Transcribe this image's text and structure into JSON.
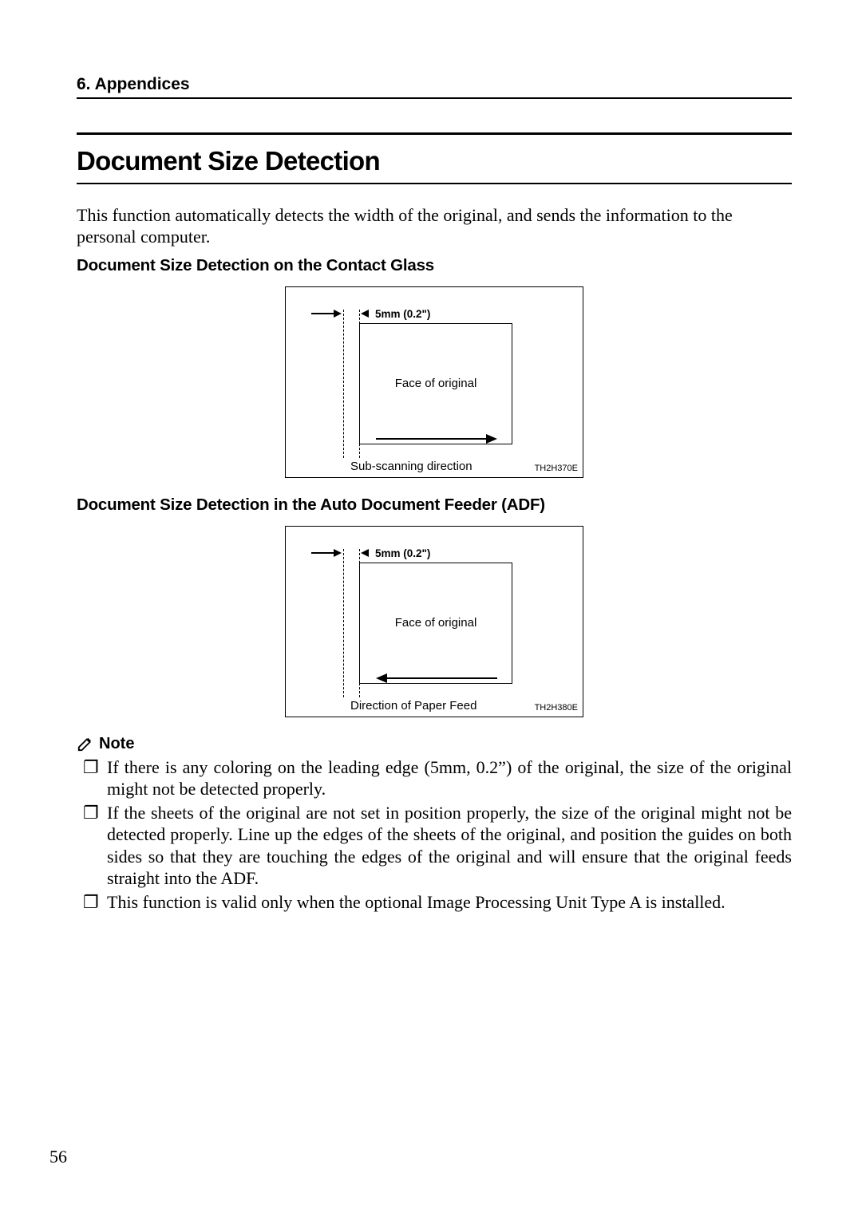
{
  "header": {
    "text": "6. Appendices"
  },
  "title": "Document Size Detection",
  "intro": "This function automatically detects the width of the original, and sends the information to the personal computer.",
  "sub1": "Document Size Detection on the Contact Glass",
  "fig1": {
    "dim": "5mm (0.2\")",
    "face": "Face of original",
    "caption": "Sub-scanning direction",
    "ref": "TH2H370E",
    "arrow_direction": "right"
  },
  "sub2": "Document Size Detection in the Auto Document Feeder (ADF)",
  "fig2": {
    "dim": "5mm (0.2\")",
    "face": "Face of original",
    "caption": "Direction of Paper Feed",
    "ref": "TH2H380E",
    "arrow_direction": "left"
  },
  "note_label": "Note",
  "notes": [
    "If there is any coloring on the leading edge (5mm, 0.2”) of the original, the size of the original might not be detected properly.",
    "If the sheets of the original are not set in position properly, the size of the original might not be detected properly.  Line up the edges of the sheets of the original, and position the guides on both sides so that they are touching the edges of the original and will ensure that the original feeds straight into the ADF.",
    "This function is valid only when the optional Image Processing Unit Type A is installed."
  ],
  "page_number": "56"
}
